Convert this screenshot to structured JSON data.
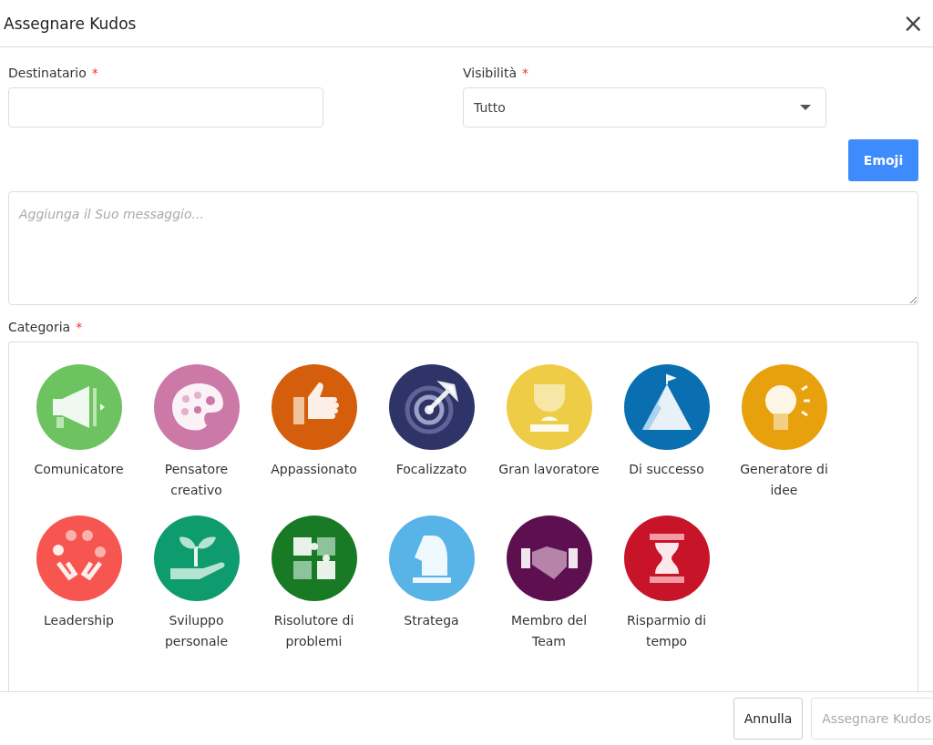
{
  "dialog": {
    "title": "Assegnare Kudos",
    "close": "×"
  },
  "fields": [
    {
      "kind": "text",
      "label": "Destinatario",
      "required": "*"
    },
    {
      "kind": "select",
      "label": "Visibilità",
      "required": "*",
      "value": "Tutto"
    }
  ],
  "emoji_button": "Emoji",
  "message": {
    "placeholder": "Aggiunga il Suo messaggio..."
  },
  "category": {
    "label": "Categoria",
    "required": "*"
  },
  "categories": [
    {
      "label": "Comunicatore",
      "color": "#6cc35f"
    },
    {
      "label": "Pensatore creativo",
      "color": "#cc79a8"
    },
    {
      "label": "Appassionato",
      "color": "#d45e0c"
    },
    {
      "label": "Focalizzato",
      "color": "#2e3468"
    },
    {
      "label": "Gran lavoratore",
      "color": "#efcc45"
    },
    {
      "label": "Di successo",
      "color": "#0a6fb1"
    },
    {
      "label": "Generatore di idee",
      "color": "#e7a10c"
    },
    {
      "label": "Leadership",
      "color": "#f6564f"
    },
    {
      "label": "Sviluppo personale",
      "color": "#0e9b6e"
    },
    {
      "label": "Risolutore di problemi",
      "color": "#187a25"
    },
    {
      "label": "Stratega",
      "color": "#58b3e6"
    },
    {
      "label": "Membro del Team",
      "color": "#5e0f50"
    },
    {
      "label": "Risparmio di tempo",
      "color": "#c81428"
    }
  ],
  "buttons": [
    {
      "label": "Annulla",
      "disabled": false,
      "kind": "secondary"
    },
    {
      "label": "Assegnare Kudos",
      "disabled": true,
      "kind": "primary"
    }
  ]
}
